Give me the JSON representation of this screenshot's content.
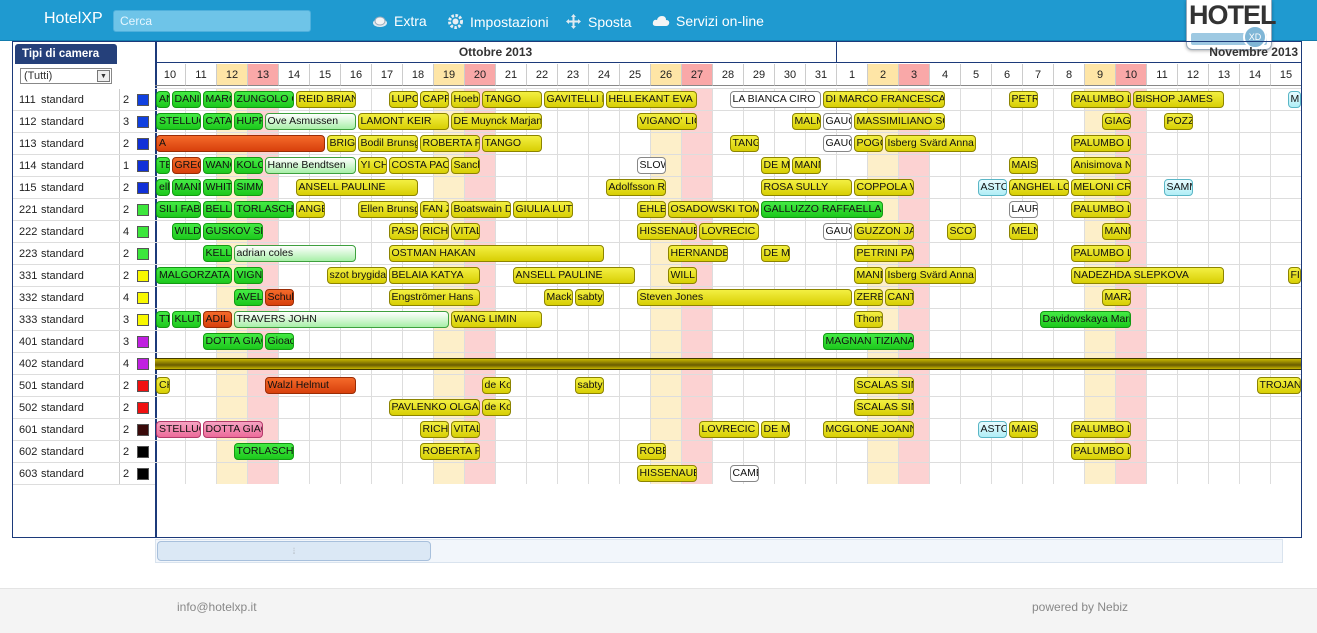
{
  "header": {
    "app_title": "HotelXP",
    "search_placeholder": "Cerca",
    "nav": [
      {
        "label": "Extra",
        "icon": "coffee-cup-icon"
      },
      {
        "label": "Impostazioni",
        "icon": "gear-icon"
      },
      {
        "label": "Sposta",
        "icon": "move-arrows-icon"
      },
      {
        "label": "Servizi on-line",
        "icon": "cloud-icon"
      }
    ],
    "logo_text": "HOTEL",
    "logo_sub": "XD"
  },
  "filter": {
    "title": "Tipi di camera",
    "selected": "(Tutti)"
  },
  "calendar": {
    "months": [
      {
        "label": "Ottobre 2013",
        "days": 22
      },
      {
        "label": "Novembre 2013",
        "days": 15
      }
    ],
    "days": [
      "10",
      "11",
      "12",
      "13",
      "14",
      "15",
      "16",
      "17",
      "18",
      "19",
      "20",
      "21",
      "22",
      "23",
      "24",
      "25",
      "26",
      "27",
      "28",
      "29",
      "30",
      "31",
      "1",
      "2",
      "3",
      "4",
      "5",
      "6",
      "7",
      "8",
      "9",
      "10",
      "11",
      "12",
      "13",
      "14",
      "15"
    ],
    "saturday_index": [
      2,
      9,
      16,
      23,
      30
    ],
    "sunday_index": [
      3,
      10,
      17,
      24,
      31
    ]
  },
  "colors": {
    "header_blue": "#1f9ad0",
    "panel_border": "#1c3a7a",
    "booked_yellow": "#e6df1c",
    "booked_green": "#2ed62e",
    "booked_orange": "#e9561a",
    "booked_pink": "#f08ab0",
    "saturday": "#fdefc9",
    "sunday": "#fcd2d2",
    "maintenance": "#8c7a00"
  },
  "rooms": [
    {
      "num": "111",
      "type": "standard",
      "cap": "2",
      "color": "#1040e0"
    },
    {
      "num": "112",
      "type": "standard",
      "cap": "3",
      "color": "#1040e0"
    },
    {
      "num": "113",
      "type": "standard",
      "cap": "2",
      "color": "#1030d8"
    },
    {
      "num": "114",
      "type": "standard",
      "cap": "1",
      "color": "#1030d8"
    },
    {
      "num": "115",
      "type": "standard",
      "cap": "2",
      "color": "#1030d8"
    },
    {
      "num": "221",
      "type": "standard",
      "cap": "2",
      "color": "#3ce63c"
    },
    {
      "num": "222",
      "type": "standard",
      "cap": "4",
      "color": "#3ce63c"
    },
    {
      "num": "223",
      "type": "standard",
      "cap": "2",
      "color": "#3ce63c"
    },
    {
      "num": "331",
      "type": "standard",
      "cap": "2",
      "color": "#f8f800"
    },
    {
      "num": "332",
      "type": "standard",
      "cap": "4",
      "color": "#f8f800"
    },
    {
      "num": "333",
      "type": "standard",
      "cap": "3",
      "color": "#f8f800"
    },
    {
      "num": "401",
      "type": "standard",
      "cap": "3",
      "color": "#c020e0"
    },
    {
      "num": "402",
      "type": "standard",
      "cap": "4",
      "color": "#c020e0"
    },
    {
      "num": "501",
      "type": "standard",
      "cap": "2",
      "color": "#f01010"
    },
    {
      "num": "502",
      "type": "standard",
      "cap": "2",
      "color": "#f01010"
    },
    {
      "num": "601",
      "type": "standard",
      "cap": "2",
      "color": "#3a0a0a"
    },
    {
      "num": "602",
      "type": "standard",
      "cap": "2",
      "color": "#000000"
    },
    {
      "num": "603",
      "type": "standard",
      "cap": "2",
      "color": "#000000"
    }
  ],
  "bookings": [
    {
      "r": 0,
      "s": 0,
      "l": 0.5,
      "t": "AN",
      "c": "g"
    },
    {
      "r": 0,
      "s": 0.5,
      "l": 1,
      "t": "DANIE",
      "c": "g"
    },
    {
      "r": 0,
      "s": 1.5,
      "l": 1,
      "t": "MARC",
      "c": "g"
    },
    {
      "r": 0,
      "s": 2.5,
      "l": 2,
      "t": "ZUNGOLO C",
      "c": "g"
    },
    {
      "r": 0,
      "s": 4.5,
      "l": 2,
      "t": "REID BRIAN",
      "c": "y"
    },
    {
      "r": 0,
      "s": 7.5,
      "l": 1,
      "t": "LUPO",
      "c": "y"
    },
    {
      "r": 0,
      "s": 8.5,
      "l": 1,
      "t": "CAPPI",
      "c": "y"
    },
    {
      "r": 0,
      "s": 9.5,
      "l": 1,
      "t": "Hoebe",
      "c": "y"
    },
    {
      "r": 0,
      "s": 10.5,
      "l": 2,
      "t": "TANGO",
      "c": "y"
    },
    {
      "r": 0,
      "s": 12.5,
      "l": 2,
      "t": "GAVITELLI M",
      "c": "y"
    },
    {
      "r": 0,
      "s": 14.5,
      "l": 3,
      "t": "HELLEKANT EVA",
      "c": "y"
    },
    {
      "r": 0,
      "s": 18.5,
      "l": 3,
      "t": "LA BIANCA CIRO",
      "c": "w"
    },
    {
      "r": 0,
      "s": 21.5,
      "l": 4,
      "t": "DI MARCO FRANCESCA",
      "c": "y"
    },
    {
      "r": 0,
      "s": 27.5,
      "l": 1,
      "t": "PETRO",
      "c": "y"
    },
    {
      "r": 0,
      "s": 29.5,
      "l": 2,
      "t": "PALUMBO LI",
      "c": "y"
    },
    {
      "r": 0,
      "s": 31.5,
      "l": 3,
      "t": "BISHOP JAMES",
      "c": "y"
    },
    {
      "r": 0,
      "s": 36.5,
      "l": 0.5,
      "t": "MI",
      "c": "c"
    },
    {
      "r": 1,
      "s": 0,
      "l": 1.5,
      "t": "STELLUCC",
      "c": "g"
    },
    {
      "r": 1,
      "s": 1.5,
      "l": 1,
      "t": "CATA",
      "c": "g"
    },
    {
      "r": 1,
      "s": 2.5,
      "l": 1,
      "t": "HUPPE",
      "c": "g"
    },
    {
      "r": 1,
      "s": 3.5,
      "l": 3,
      "t": "Ove Asmussen",
      "c": "lg"
    },
    {
      "r": 1,
      "s": 6.5,
      "l": 3,
      "t": "LAMONT KEIR",
      "c": "y"
    },
    {
      "r": 1,
      "s": 9.5,
      "l": 3,
      "t": "DE Muynck Marjan",
      "c": "y"
    },
    {
      "r": 1,
      "s": 15.5,
      "l": 2,
      "t": "VIGANO' LIC",
      "c": "y"
    },
    {
      "r": 1,
      "s": 20.5,
      "l": 1,
      "t": "MALM",
      "c": "y"
    },
    {
      "r": 1,
      "s": 21.5,
      "l": 1,
      "t": "GAUC",
      "c": "w"
    },
    {
      "r": 1,
      "s": 22.5,
      "l": 3,
      "t": "MASSIMILIANO SCA",
      "c": "y"
    },
    {
      "r": 1,
      "s": 30.5,
      "l": 1,
      "t": "GIAGN",
      "c": "y"
    },
    {
      "r": 1,
      "s": 32.5,
      "l": 1,
      "t": "POZZ",
      "c": "y"
    },
    {
      "r": 2,
      "s": 0,
      "l": 5.5,
      "t": "A",
      "c": "o"
    },
    {
      "r": 2,
      "s": 5.5,
      "l": 1,
      "t": "BRIGH",
      "c": "y"
    },
    {
      "r": 2,
      "s": 6.5,
      "l": 2,
      "t": "Bodil Brunsg",
      "c": "y"
    },
    {
      "r": 2,
      "s": 8.5,
      "l": 2,
      "t": "ROBERTA FIC",
      "c": "y"
    },
    {
      "r": 2,
      "s": 10.5,
      "l": 2,
      "t": "TANGO",
      "c": "y"
    },
    {
      "r": 2,
      "s": 18.5,
      "l": 1,
      "t": "TANG",
      "c": "y"
    },
    {
      "r": 2,
      "s": 21.5,
      "l": 1,
      "t": "GAUC",
      "c": "w"
    },
    {
      "r": 2,
      "s": 22.5,
      "l": 1,
      "t": "POGG",
      "c": "y"
    },
    {
      "r": 2,
      "s": 23.5,
      "l": 3,
      "t": "Isberg Svärd Anna",
      "c": "y"
    },
    {
      "r": 2,
      "s": 29.5,
      "l": 2,
      "t": "PALUMBO LI",
      "c": "y"
    },
    {
      "r": 3,
      "s": 0,
      "l": 0.5,
      "t": "TEI",
      "c": "g"
    },
    {
      "r": 3,
      "s": 0.5,
      "l": 1,
      "t": "GRECO",
      "c": "o"
    },
    {
      "r": 3,
      "s": 1.5,
      "l": 1,
      "t": "WANG",
      "c": "g"
    },
    {
      "r": 3,
      "s": 2.5,
      "l": 1,
      "t": "KOLO",
      "c": "g"
    },
    {
      "r": 3,
      "s": 3.5,
      "l": 3,
      "t": "Hanne Bendtsen",
      "c": "lg"
    },
    {
      "r": 3,
      "s": 6.5,
      "l": 1,
      "t": "YI CHI",
      "c": "y"
    },
    {
      "r": 3,
      "s": 7.5,
      "l": 2,
      "t": "COSTA PAOI",
      "c": "y"
    },
    {
      "r": 3,
      "s": 9.5,
      "l": 1,
      "t": "Sanch",
      "c": "y"
    },
    {
      "r": 3,
      "s": 15.5,
      "l": 1,
      "t": "SLOW",
      "c": "w"
    },
    {
      "r": 3,
      "s": 19.5,
      "l": 1,
      "t": "DE ME",
      "c": "y"
    },
    {
      "r": 3,
      "s": 20.5,
      "l": 1,
      "t": "MANN",
      "c": "y"
    },
    {
      "r": 3,
      "s": 27.5,
      "l": 1,
      "t": "MAIST",
      "c": "y"
    },
    {
      "r": 3,
      "s": 29.5,
      "l": 2,
      "t": "Anisimova N",
      "c": "y"
    },
    {
      "r": 4,
      "s": 0,
      "l": 0.5,
      "t": "ell",
      "c": "g"
    },
    {
      "r": 4,
      "s": 0.5,
      "l": 1,
      "t": "MANN",
      "c": "g"
    },
    {
      "r": 4,
      "s": 1.5,
      "l": 1,
      "t": "WHITE",
      "c": "g"
    },
    {
      "r": 4,
      "s": 2.5,
      "l": 1,
      "t": "SIMMC",
      "c": "g"
    },
    {
      "r": 4,
      "s": 4.5,
      "l": 4,
      "t": "ANSELL PAULINE",
      "c": "y"
    },
    {
      "r": 4,
      "s": 14.5,
      "l": 2,
      "t": "Adolfsson R",
      "c": "y"
    },
    {
      "r": 4,
      "s": 19.5,
      "l": 3,
      "t": "ROSA SULLY",
      "c": "y"
    },
    {
      "r": 4,
      "s": 22.5,
      "l": 2,
      "t": "COPPOLA V",
      "c": "y"
    },
    {
      "r": 4,
      "s": 26.5,
      "l": 1,
      "t": "ASTOI",
      "c": "c"
    },
    {
      "r": 4,
      "s": 27.5,
      "l": 2,
      "t": "ANGHEL LOR",
      "c": "y"
    },
    {
      "r": 4,
      "s": 29.5,
      "l": 2,
      "t": "MELONI CRIS",
      "c": "y"
    },
    {
      "r": 4,
      "s": 32.5,
      "l": 1,
      "t": "SAMM",
      "c": "c"
    },
    {
      "r": 5,
      "s": 0,
      "l": 1.5,
      "t": "SILI FABIO",
      "c": "g"
    },
    {
      "r": 5,
      "s": 1.5,
      "l": 1,
      "t": "BELLU",
      "c": "g"
    },
    {
      "r": 5,
      "s": 2.5,
      "l": 2,
      "t": "TORLASCHI I",
      "c": "g"
    },
    {
      "r": 5,
      "s": 4.5,
      "l": 1,
      "t": "ANGE",
      "c": "y"
    },
    {
      "r": 5,
      "s": 6.5,
      "l": 2,
      "t": "Ellen Brunsg",
      "c": "y"
    },
    {
      "r": 5,
      "s": 8.5,
      "l": 1,
      "t": "FAN Z",
      "c": "y"
    },
    {
      "r": 5,
      "s": 9.5,
      "l": 2,
      "t": "Boatswain D",
      "c": "y"
    },
    {
      "r": 5,
      "s": 11.5,
      "l": 2,
      "t": "GIULIA LUTZ",
      "c": "y"
    },
    {
      "r": 5,
      "s": 15.5,
      "l": 1,
      "t": "EHLER",
      "c": "y"
    },
    {
      "r": 5,
      "s": 16.5,
      "l": 3,
      "t": "OSADOWSKI TOMA",
      "c": "y"
    },
    {
      "r": 5,
      "s": 19.5,
      "l": 4,
      "t": "GALLUZZO RAFFAELLA",
      "c": "g"
    },
    {
      "r": 5,
      "s": 27.5,
      "l": 1,
      "t": "LAURE",
      "c": "w"
    },
    {
      "r": 5,
      "s": 29.5,
      "l": 2,
      "t": "PALUMBO LI",
      "c": "y"
    },
    {
      "r": 6,
      "s": 0.5,
      "l": 1,
      "t": "WILD",
      "c": "g"
    },
    {
      "r": 6,
      "s": 1.5,
      "l": 2,
      "t": "GUSKOV SER",
      "c": "g"
    },
    {
      "r": 6,
      "s": 7.5,
      "l": 1,
      "t": "PASHC",
      "c": "y"
    },
    {
      "r": 6,
      "s": 8.5,
      "l": 1,
      "t": "RICHT",
      "c": "y"
    },
    {
      "r": 6,
      "s": 9.5,
      "l": 1,
      "t": "VITAL",
      "c": "y"
    },
    {
      "r": 6,
      "s": 15.5,
      "l": 2,
      "t": "HISSENAUER",
      "c": "y"
    },
    {
      "r": 6,
      "s": 17.5,
      "l": 2,
      "t": "LOVRECIC M",
      "c": "y"
    },
    {
      "r": 6,
      "s": 21.5,
      "l": 1,
      "t": "GAUC",
      "c": "w"
    },
    {
      "r": 6,
      "s": 22.5,
      "l": 2,
      "t": "GUZZON JAC",
      "c": "y"
    },
    {
      "r": 6,
      "s": 25.5,
      "l": 1,
      "t": "SCOTT",
      "c": "y"
    },
    {
      "r": 6,
      "s": 27.5,
      "l": 1,
      "t": "MELNI",
      "c": "y"
    },
    {
      "r": 6,
      "s": 30.5,
      "l": 1,
      "t": "MANN",
      "c": "y"
    },
    {
      "r": 7,
      "s": 1.5,
      "l": 1,
      "t": "KELLY",
      "c": "g"
    },
    {
      "r": 7,
      "s": 2.5,
      "l": 4,
      "t": "adrian coles",
      "c": "lg"
    },
    {
      "r": 7,
      "s": 7.5,
      "l": 7,
      "t": "OSTMAN HAKAN",
      "c": "y"
    },
    {
      "r": 7,
      "s": 16.5,
      "l": 2,
      "t": "HERNANDEZ",
      "c": "y"
    },
    {
      "r": 7,
      "s": 19.5,
      "l": 1,
      "t": "DE ME",
      "c": "y"
    },
    {
      "r": 7,
      "s": 22.5,
      "l": 2,
      "t": "PETRINI PAO",
      "c": "y"
    },
    {
      "r": 7,
      "s": 29.5,
      "l": 2,
      "t": "PALUMBO LI",
      "c": "y"
    },
    {
      "r": 8,
      "s": 0,
      "l": 2.5,
      "t": "MALGORZATA",
      "c": "g"
    },
    {
      "r": 8,
      "s": 2.5,
      "l": 1,
      "t": "VIGNE",
      "c": "g"
    },
    {
      "r": 8,
      "s": 5.5,
      "l": 2,
      "t": "szot brygida",
      "c": "y"
    },
    {
      "r": 8,
      "s": 7.5,
      "l": 3,
      "t": "BELAIA KATYA",
      "c": "y"
    },
    {
      "r": 8,
      "s": 11.5,
      "l": 4,
      "t": "ANSELL PAULINE",
      "c": "y"
    },
    {
      "r": 8,
      "s": 16.5,
      "l": 1,
      "t": "WILLIA",
      "c": "y"
    },
    {
      "r": 8,
      "s": 22.5,
      "l": 1,
      "t": "MAND",
      "c": "y"
    },
    {
      "r": 8,
      "s": 23.5,
      "l": 3,
      "t": "Isberg Svärd Anna",
      "c": "y"
    },
    {
      "r": 8,
      "s": 29.5,
      "l": 5,
      "t": "NADEZHDA SLEPKOVA",
      "c": "y"
    },
    {
      "r": 8,
      "s": 36.5,
      "l": 0.5,
      "t": "FIO",
      "c": "y"
    },
    {
      "r": 9,
      "s": 2.5,
      "l": 1,
      "t": "AVELI",
      "c": "g"
    },
    {
      "r": 9,
      "s": 3.5,
      "l": 1,
      "t": "Schub",
      "c": "o"
    },
    {
      "r": 9,
      "s": 7.5,
      "l": 3,
      "t": "Engströmer Hans",
      "c": "y"
    },
    {
      "r": 9,
      "s": 12.5,
      "l": 1,
      "t": "Mackl",
      "c": "y"
    },
    {
      "r": 9,
      "s": 13.5,
      "l": 1,
      "t": "sabty",
      "c": "y"
    },
    {
      "r": 9,
      "s": 15.5,
      "l": 7,
      "t": "Steven Jones",
      "c": "y"
    },
    {
      "r": 9,
      "s": 22.5,
      "l": 1,
      "t": "ZERBI",
      "c": "y"
    },
    {
      "r": 9,
      "s": 23.5,
      "l": 1,
      "t": "CANT",
      "c": "y"
    },
    {
      "r": 9,
      "s": 30.5,
      "l": 1,
      "t": "MARZ",
      "c": "y"
    },
    {
      "r": 10,
      "s": 0,
      "l": 0.5,
      "t": "TTE",
      "c": "g"
    },
    {
      "r": 10,
      "s": 0.5,
      "l": 1,
      "t": "KLUTS",
      "c": "g"
    },
    {
      "r": 10,
      "s": 1.5,
      "l": 1,
      "t": "ADIL",
      "c": "o"
    },
    {
      "r": 10,
      "s": 2.5,
      "l": 7,
      "t": "TRAVERS JOHN",
      "c": "lg"
    },
    {
      "r": 10,
      "s": 9.5,
      "l": 3,
      "t": "WANG LIMIN",
      "c": "y"
    },
    {
      "r": 10,
      "s": 22.5,
      "l": 1,
      "t": "Thom",
      "c": "y"
    },
    {
      "r": 10,
      "s": 28.5,
      "l": 3,
      "t": "Davidovskaya Mari",
      "c": "g"
    },
    {
      "r": 11,
      "s": 1.5,
      "l": 2,
      "t": "DOTTA GIAC",
      "c": "g"
    },
    {
      "r": 11,
      "s": 3.5,
      "l": 1,
      "t": "Gioac",
      "c": "g"
    },
    {
      "r": 11,
      "s": 21.5,
      "l": 3,
      "t": "MAGNAN TIZIANA",
      "c": "g"
    },
    {
      "r": 13,
      "s": 0,
      "l": 0.5,
      "t": "CH",
      "c": "y"
    },
    {
      "r": 13,
      "s": 3.5,
      "l": 3,
      "t": "Walzl Helmut",
      "c": "o"
    },
    {
      "r": 13,
      "s": 10.5,
      "l": 1,
      "t": "de Ko",
      "c": "y"
    },
    {
      "r": 13,
      "s": 13.5,
      "l": 1,
      "t": "sabty",
      "c": "y"
    },
    {
      "r": 13,
      "s": 22.5,
      "l": 2,
      "t": "SCALAS SIMO",
      "c": "y"
    },
    {
      "r": 13,
      "s": 35.5,
      "l": 1.5,
      "t": "TROJAN M",
      "c": "y"
    },
    {
      "r": 14,
      "s": 7.5,
      "l": 3,
      "t": "PAVLENKO OLGA",
      "c": "y"
    },
    {
      "r": 14,
      "s": 10.5,
      "l": 1,
      "t": "de Ko",
      "c": "y"
    },
    {
      "r": 14,
      "s": 22.5,
      "l": 2,
      "t": "SCALAS SIMO",
      "c": "y"
    },
    {
      "r": 15,
      "s": 0,
      "l": 1.5,
      "t": "STELLUCC",
      "c": "p"
    },
    {
      "r": 15,
      "s": 1.5,
      "l": 2,
      "t": "DOTTA GIAC",
      "c": "p"
    },
    {
      "r": 15,
      "s": 8.5,
      "l": 1,
      "t": "RICHT",
      "c": "y"
    },
    {
      "r": 15,
      "s": 9.5,
      "l": 1,
      "t": "VITAL",
      "c": "y"
    },
    {
      "r": 15,
      "s": 17.5,
      "l": 2,
      "t": "LOVRECIC M",
      "c": "y"
    },
    {
      "r": 15,
      "s": 19.5,
      "l": 1,
      "t": "DE ME",
      "c": "y"
    },
    {
      "r": 15,
      "s": 21.5,
      "l": 3,
      "t": "MCGLONE JOANNA",
      "c": "y"
    },
    {
      "r": 15,
      "s": 26.5,
      "l": 1,
      "t": "ASTOI",
      "c": "c"
    },
    {
      "r": 15,
      "s": 27.5,
      "l": 1,
      "t": "MAIST",
      "c": "y"
    },
    {
      "r": 15,
      "s": 29.5,
      "l": 2,
      "t": "PALUMBO LI",
      "c": "y"
    },
    {
      "r": 16,
      "s": 2.5,
      "l": 2,
      "t": "TORLASCHI I",
      "c": "g"
    },
    {
      "r": 16,
      "s": 8.5,
      "l": 2,
      "t": "ROBERTA FIC",
      "c": "y"
    },
    {
      "r": 16,
      "s": 15.5,
      "l": 1,
      "t": "ROBER",
      "c": "y"
    },
    {
      "r": 16,
      "s": 29.5,
      "l": 2,
      "t": "PALUMBO LI",
      "c": "y"
    },
    {
      "r": 17,
      "s": 15.5,
      "l": 2,
      "t": "HISSENAUER",
      "c": "y"
    },
    {
      "r": 17,
      "s": 18.5,
      "l": 1,
      "t": "CAMB",
      "c": "w"
    }
  ],
  "footer": {
    "email": "info@hotelxp.it",
    "powered": "powered by Nebiz"
  }
}
